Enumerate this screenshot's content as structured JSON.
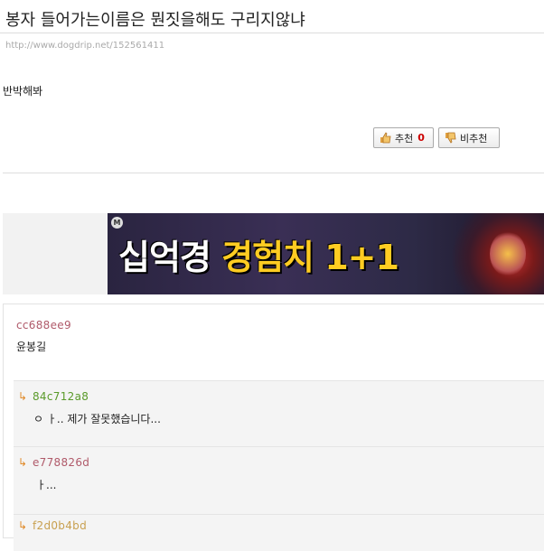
{
  "post": {
    "title": "봉자 들어가는이름은 뭔짓을해도 구리지않냐",
    "url": "http://www.dogdrip.net/152561411",
    "body": "반박해봐"
  },
  "votes": {
    "up_label": "추천",
    "up_count": "0",
    "down_label": "비추천"
  },
  "ad": {
    "badge": "M",
    "text_white": "십억경 ",
    "text_gold": "경험치 1+1"
  },
  "comments": [
    {
      "author": "cc688ee9",
      "author_color": "#b05a6a",
      "text": "윤봉길"
    }
  ],
  "replies": [
    {
      "arrow": "↳",
      "author": "84c712a8",
      "author_color": "#5a9a2a",
      "text": "ㅇ ㅏ.. 제가 잘못했습니다..."
    },
    {
      "arrow": "↳",
      "author": "e778826d",
      "author_color": "#b05a6a",
      "text": "ㅏ..."
    },
    {
      "arrow": "↳",
      "author": "f2d0b4bd",
      "author_color": "#c8a050",
      "text": ""
    }
  ],
  "colors": {
    "vote_count": "#cc0000",
    "reply_arrow": "#e08a2a"
  }
}
